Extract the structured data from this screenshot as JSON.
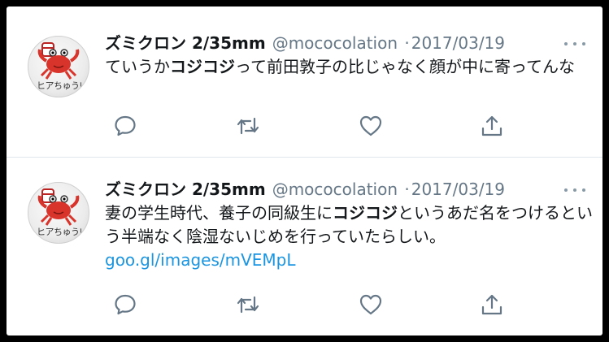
{
  "tweets": [
    {
      "author_name": "ズミクロン 2/35mm",
      "handle": "@mococolation",
      "separator": "·",
      "date": "2017/03/19",
      "avatar_text": "ヒアちゅうい",
      "body": {
        "part1": "ていうか",
        "bold1": "コジコジ",
        "part2": "って前田敦子の比じゃなく顔が中に寄ってんな"
      },
      "link": ""
    },
    {
      "author_name": "ズミクロン 2/35mm",
      "handle": "@mococolation",
      "separator": "·",
      "date": "2017/03/19",
      "avatar_text": "ヒアちゅうい",
      "body": {
        "part1": "妻の学生時代、養子の同級生に",
        "bold1": "コジコジ",
        "part2": "というあだ名をつけるという半端なく陰湿ないじめを行っていたらしい。"
      },
      "link": "goo.gl/images/mVEMpL"
    }
  ],
  "icons": {
    "reply": "reply-icon",
    "retweet": "retweet-icon",
    "like": "like-icon",
    "share": "share-icon",
    "more": "more-icon"
  },
  "colors": {
    "text": "#14171a",
    "secondary": "#657786",
    "link": "#1b95e0",
    "icon": "#657786",
    "divider": "#e1e8ed"
  }
}
